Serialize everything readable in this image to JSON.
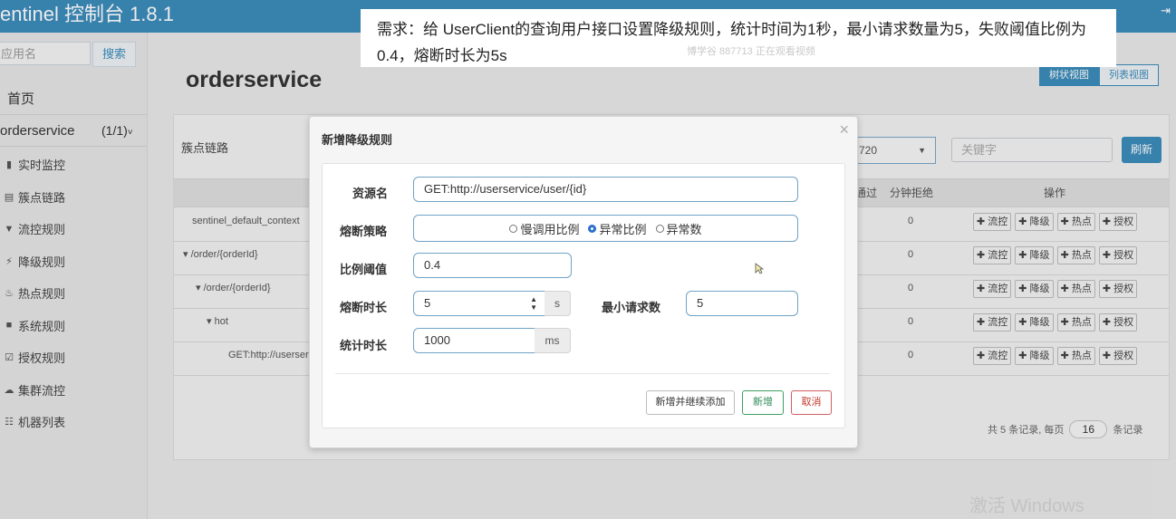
{
  "header": {
    "brand": "entinel 控制台 1.8.1",
    "exit_icon": "exit-icon"
  },
  "sidebar": {
    "search_placeholder": "应用名",
    "search_button": "搜索",
    "home": "首页",
    "app_name": "orderservice",
    "app_count": "(1/1)",
    "items": [
      {
        "icon": "bar-chart-icon",
        "glyph": "▮",
        "label": "实时监控"
      },
      {
        "icon": "list-icon",
        "glyph": "▤",
        "label": "簇点链路"
      },
      {
        "icon": "filter-icon",
        "glyph": "▼",
        "label": "流控规则"
      },
      {
        "icon": "bolt-icon",
        "glyph": "⚡",
        "label": "降级规则"
      },
      {
        "icon": "fire-icon",
        "glyph": "♨",
        "label": "热点规则"
      },
      {
        "icon": "lock-icon",
        "glyph": "■",
        "label": "系统规则"
      },
      {
        "icon": "check-icon",
        "glyph": "☑",
        "label": "授权规则"
      },
      {
        "icon": "cloud-icon",
        "glyph": "☁",
        "label": "集群流控"
      },
      {
        "icon": "th-list-icon",
        "glyph": "☷",
        "label": "机器列表"
      }
    ]
  },
  "main": {
    "title": "orderservice",
    "view_tree": "树状视图",
    "view_list": "列表视图",
    "panel_title": "簇点链路",
    "machine_value": "720",
    "keyword_placeholder": "关键字",
    "refresh": "刷新",
    "columns": {
      "pass": "通过",
      "reject": "分钟拒绝",
      "ops": "操作"
    },
    "rows": [
      {
        "name": "sentinel_default_context",
        "indent": 20,
        "value": "0"
      },
      {
        "name": "▾ /order/{orderId}",
        "indent": 10,
        "value": "0"
      },
      {
        "name": "▾ /order/{orderId}",
        "indent": 24,
        "value": "0"
      },
      {
        "name": "▾ hot",
        "indent": 36,
        "value": "0"
      },
      {
        "name": "GET:http://userserv",
        "indent": 60,
        "value": "0"
      }
    ],
    "op_buttons": [
      "✚ 流控",
      "✚ 降级",
      "✚ 热点",
      "✚ 授权"
    ],
    "pager_prefix": "共 5 条记录, 每页",
    "pager_size": "16",
    "pager_suffix": "条记录"
  },
  "caption": {
    "text": "需求：给 UserClient的查询用户接口设置降级规则，统计时间为1秒，最小请求数量为5，失败阈值比例为0.4，熔断时长为5s",
    "sub": "博学谷 887713 正在观看视频"
  },
  "dialog": {
    "title": "新增降级规则",
    "close": "×",
    "resource_label": "资源名",
    "resource_value": "GET:http://userservice/user/{id}",
    "strategy_label": "熔断策略",
    "strategies": [
      {
        "label": "慢调用比例",
        "selected": false
      },
      {
        "label": "异常比例",
        "selected": true
      },
      {
        "label": "异常数",
        "selected": false
      }
    ],
    "ratio_label": "比例阈值",
    "ratio_value": "0.4",
    "duration_label": "熔断时长",
    "duration_value": "5",
    "duration_unit": "s",
    "min_req_label": "最小请求数",
    "min_req_value": "5",
    "stat_label": "统计时长",
    "stat_value": "1000",
    "stat_unit": "ms",
    "btn_continue": "新增并继续添加",
    "btn_add": "新增",
    "btn_cancel": "取消"
  },
  "watermark": "激活 Windows"
}
